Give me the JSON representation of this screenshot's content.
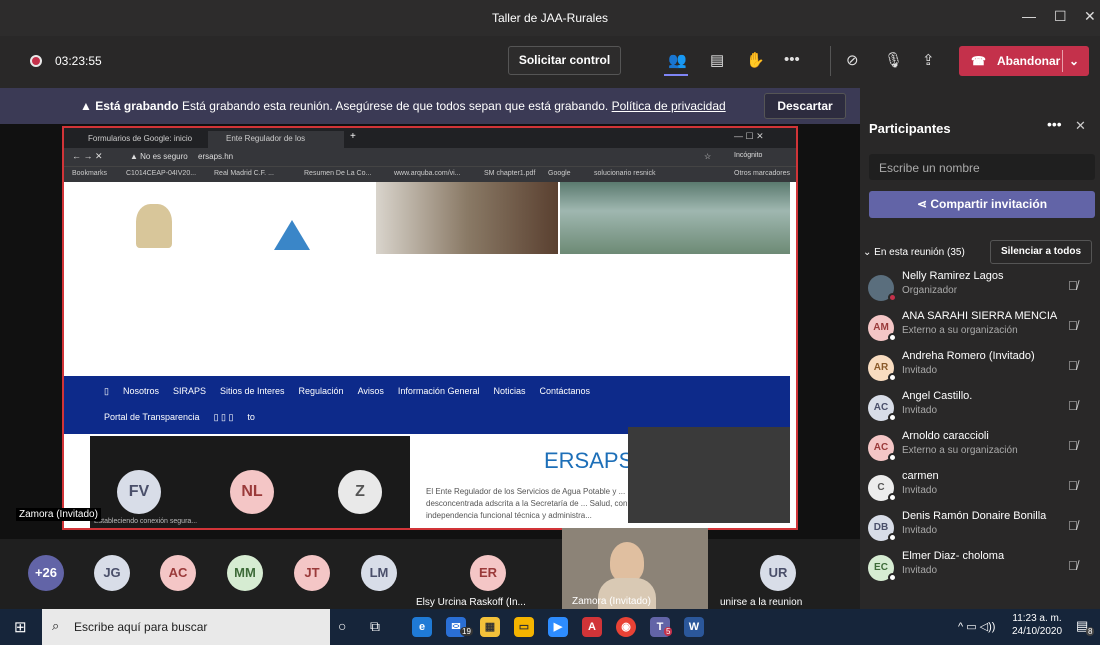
{
  "window": {
    "title": "Taller de JAA-Rurales"
  },
  "toolbar": {
    "timer": "03:23:55",
    "request_control": "Solicitar control",
    "leave": "Abandonar"
  },
  "banner": {
    "bold": "Está grabando",
    "text": "Está grabando esta reunión. Asegúrese de que todos sepan que está grabando.",
    "link": "Política de privacidad",
    "dismiss": "Descartar"
  },
  "browser": {
    "tab1": "Formularios de Google: inicio de...",
    "tab2": "Ente Regulador de los Servicios...",
    "insecure": "No es seguro",
    "url": "ersaps.hn",
    "incognito": "Incógnito",
    "bookmarks": [
      "Bookmarks",
      "C1014CEAP-04IV20...",
      "Real Madrid C.F. ...",
      "Resumen De La Co...",
      "www.arquba.com/vi...",
      "SM chapter1.pdf",
      "Google",
      "solucionario resnick",
      "Otros marcadores"
    ]
  },
  "site": {
    "nav": [
      "Nosotros",
      "SIRAPS",
      "Sitios de Interes",
      "Regulación",
      "Avisos",
      "Información General",
      "Noticias",
      "Contáctanos"
    ],
    "nav2": [
      "Portal de Transparencia",
      "to"
    ],
    "title": "ERSAPS",
    "body": "El Ente Regulador de los Servicios de Agua Potable y ... institución desconcentrada adscrita a la Secretaría de ... Salud, con independencia funcional técnica y administra...",
    "connecting": "Estableciendo conexión segura..."
  },
  "inner_pip": [
    "FV",
    "NL",
    "Z"
  ],
  "zamora_label": "Zamora (Invitado)",
  "stripe": {
    "overflow": "+26",
    "avatars": [
      "JG",
      "AC",
      "MM",
      "JT",
      "LM"
    ],
    "er": {
      "initials": "ER",
      "label": "Elsy Urcina Raskoff (In..."
    },
    "video_label": "Zamora (Invitado)",
    "ur": {
      "initials": "UR",
      "label": "unirse a la reunion"
    }
  },
  "panel": {
    "title": "Participantes",
    "search_placeholder": "Escribe un nombre",
    "invite": "Compartir invitación",
    "section": "En esta reunión (35)",
    "mute_all": "Silenciar a todos",
    "people": [
      {
        "initials": "",
        "name": "Nelly Ramirez Lagos",
        "role": "Organizador",
        "bg": "#5a6e7d"
      },
      {
        "initials": "AM",
        "name": "ANA SARAHI SIERRA MENCIA",
        "role": "Externo a su organización",
        "bg": "#f4c6c6"
      },
      {
        "initials": "AR",
        "name": "Andreha Romero (Invitado)",
        "role": "Invitado",
        "bg": "#f8dcc0"
      },
      {
        "initials": "AC",
        "name": "Angel Castillo.",
        "role": "Invitado",
        "bg": "#d8dde8"
      },
      {
        "initials": "AC",
        "name": "Arnoldo caraccioli",
        "role": "Externo a su organización",
        "bg": "#f4c6c6"
      },
      {
        "initials": "C",
        "name": "carmen",
        "role": "Invitado",
        "bg": "#ececec"
      },
      {
        "initials": "DB",
        "name": "Denis Ramón Donaire Bonilla",
        "role": "Invitado",
        "bg": "#d8dde8"
      },
      {
        "initials": "EC",
        "name": "Elmer Diaz- choloma",
        "role": "Invitado",
        "bg": "#d6ecd2"
      }
    ]
  },
  "taskbar": {
    "search": "Escribe aquí para buscar",
    "time": "11:23 a. m.",
    "date": "24/10/2020",
    "mail_badge": "19",
    "teams_badge": "5",
    "notif": "8"
  }
}
